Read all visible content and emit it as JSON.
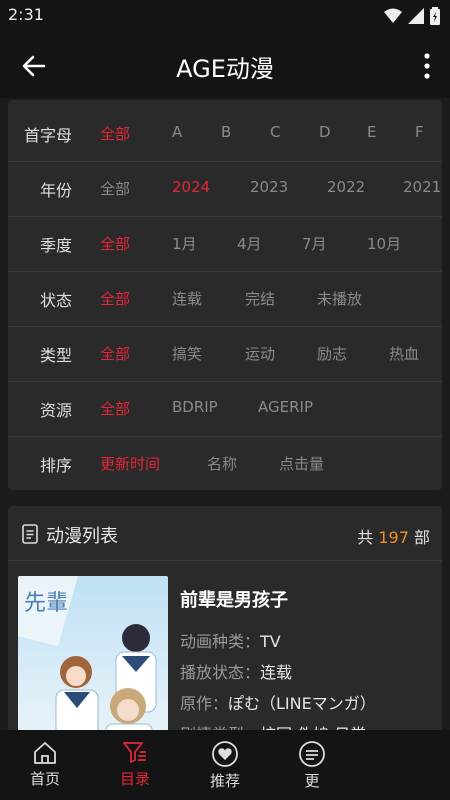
{
  "status_bar": {
    "time": "2:31"
  },
  "app_bar": {
    "title": "AGE动漫"
  },
  "filters": [
    {
      "label": "首字母",
      "options": [
        "全部",
        "A",
        "B",
        "C",
        "D",
        "E",
        "F"
      ],
      "selected": 0
    },
    {
      "label": "年份",
      "options": [
        "全部",
        "2024",
        "2023",
        "2022",
        "2021"
      ],
      "selected": 1
    },
    {
      "label": "季度",
      "options": [
        "全部",
        "1月",
        "4月",
        "7月",
        "10月"
      ],
      "selected": 0
    },
    {
      "label": "状态",
      "options": [
        "全部",
        "连载",
        "完结",
        "未播放"
      ],
      "selected": 0
    },
    {
      "label": "类型",
      "options": [
        "全部",
        "搞笑",
        "运动",
        "励志",
        "热血"
      ],
      "selected": 0
    },
    {
      "label": "资源",
      "options": [
        "全部",
        "BDRIP",
        "AGERIP"
      ],
      "selected": 0
    },
    {
      "label": "排序",
      "options": [
        "更新时间",
        "名称",
        "点击量"
      ],
      "selected": 0
    }
  ],
  "list": {
    "title": "动漫列表",
    "count_prefix": "共",
    "count": "197",
    "count_suffix": "部",
    "items": [
      {
        "title": "前辈是男孩子",
        "type_label": "动画种类：",
        "type_value": "TV",
        "status_label": "播放状态：",
        "status_value": "连载",
        "origin_label": "原作：",
        "origin_value": "ぽむ（LINEマンガ）",
        "genre_label": "剧情类型：",
        "genre_value": "校园 伪娘 日常"
      }
    ]
  },
  "bottom_nav": [
    {
      "label": "首页",
      "icon": "home-icon",
      "active": false
    },
    {
      "label": "目录",
      "icon": "catalog-filter-icon",
      "active": true
    },
    {
      "label": "推荐",
      "icon": "heart-icon",
      "active": false
    },
    {
      "label": "更",
      "icon": "more-circle-icon",
      "active": false
    }
  ],
  "colors": {
    "accent": "#e2263a",
    "count": "#f08c2a",
    "background": "#1c1c1c",
    "card": "#2a2a2a"
  }
}
